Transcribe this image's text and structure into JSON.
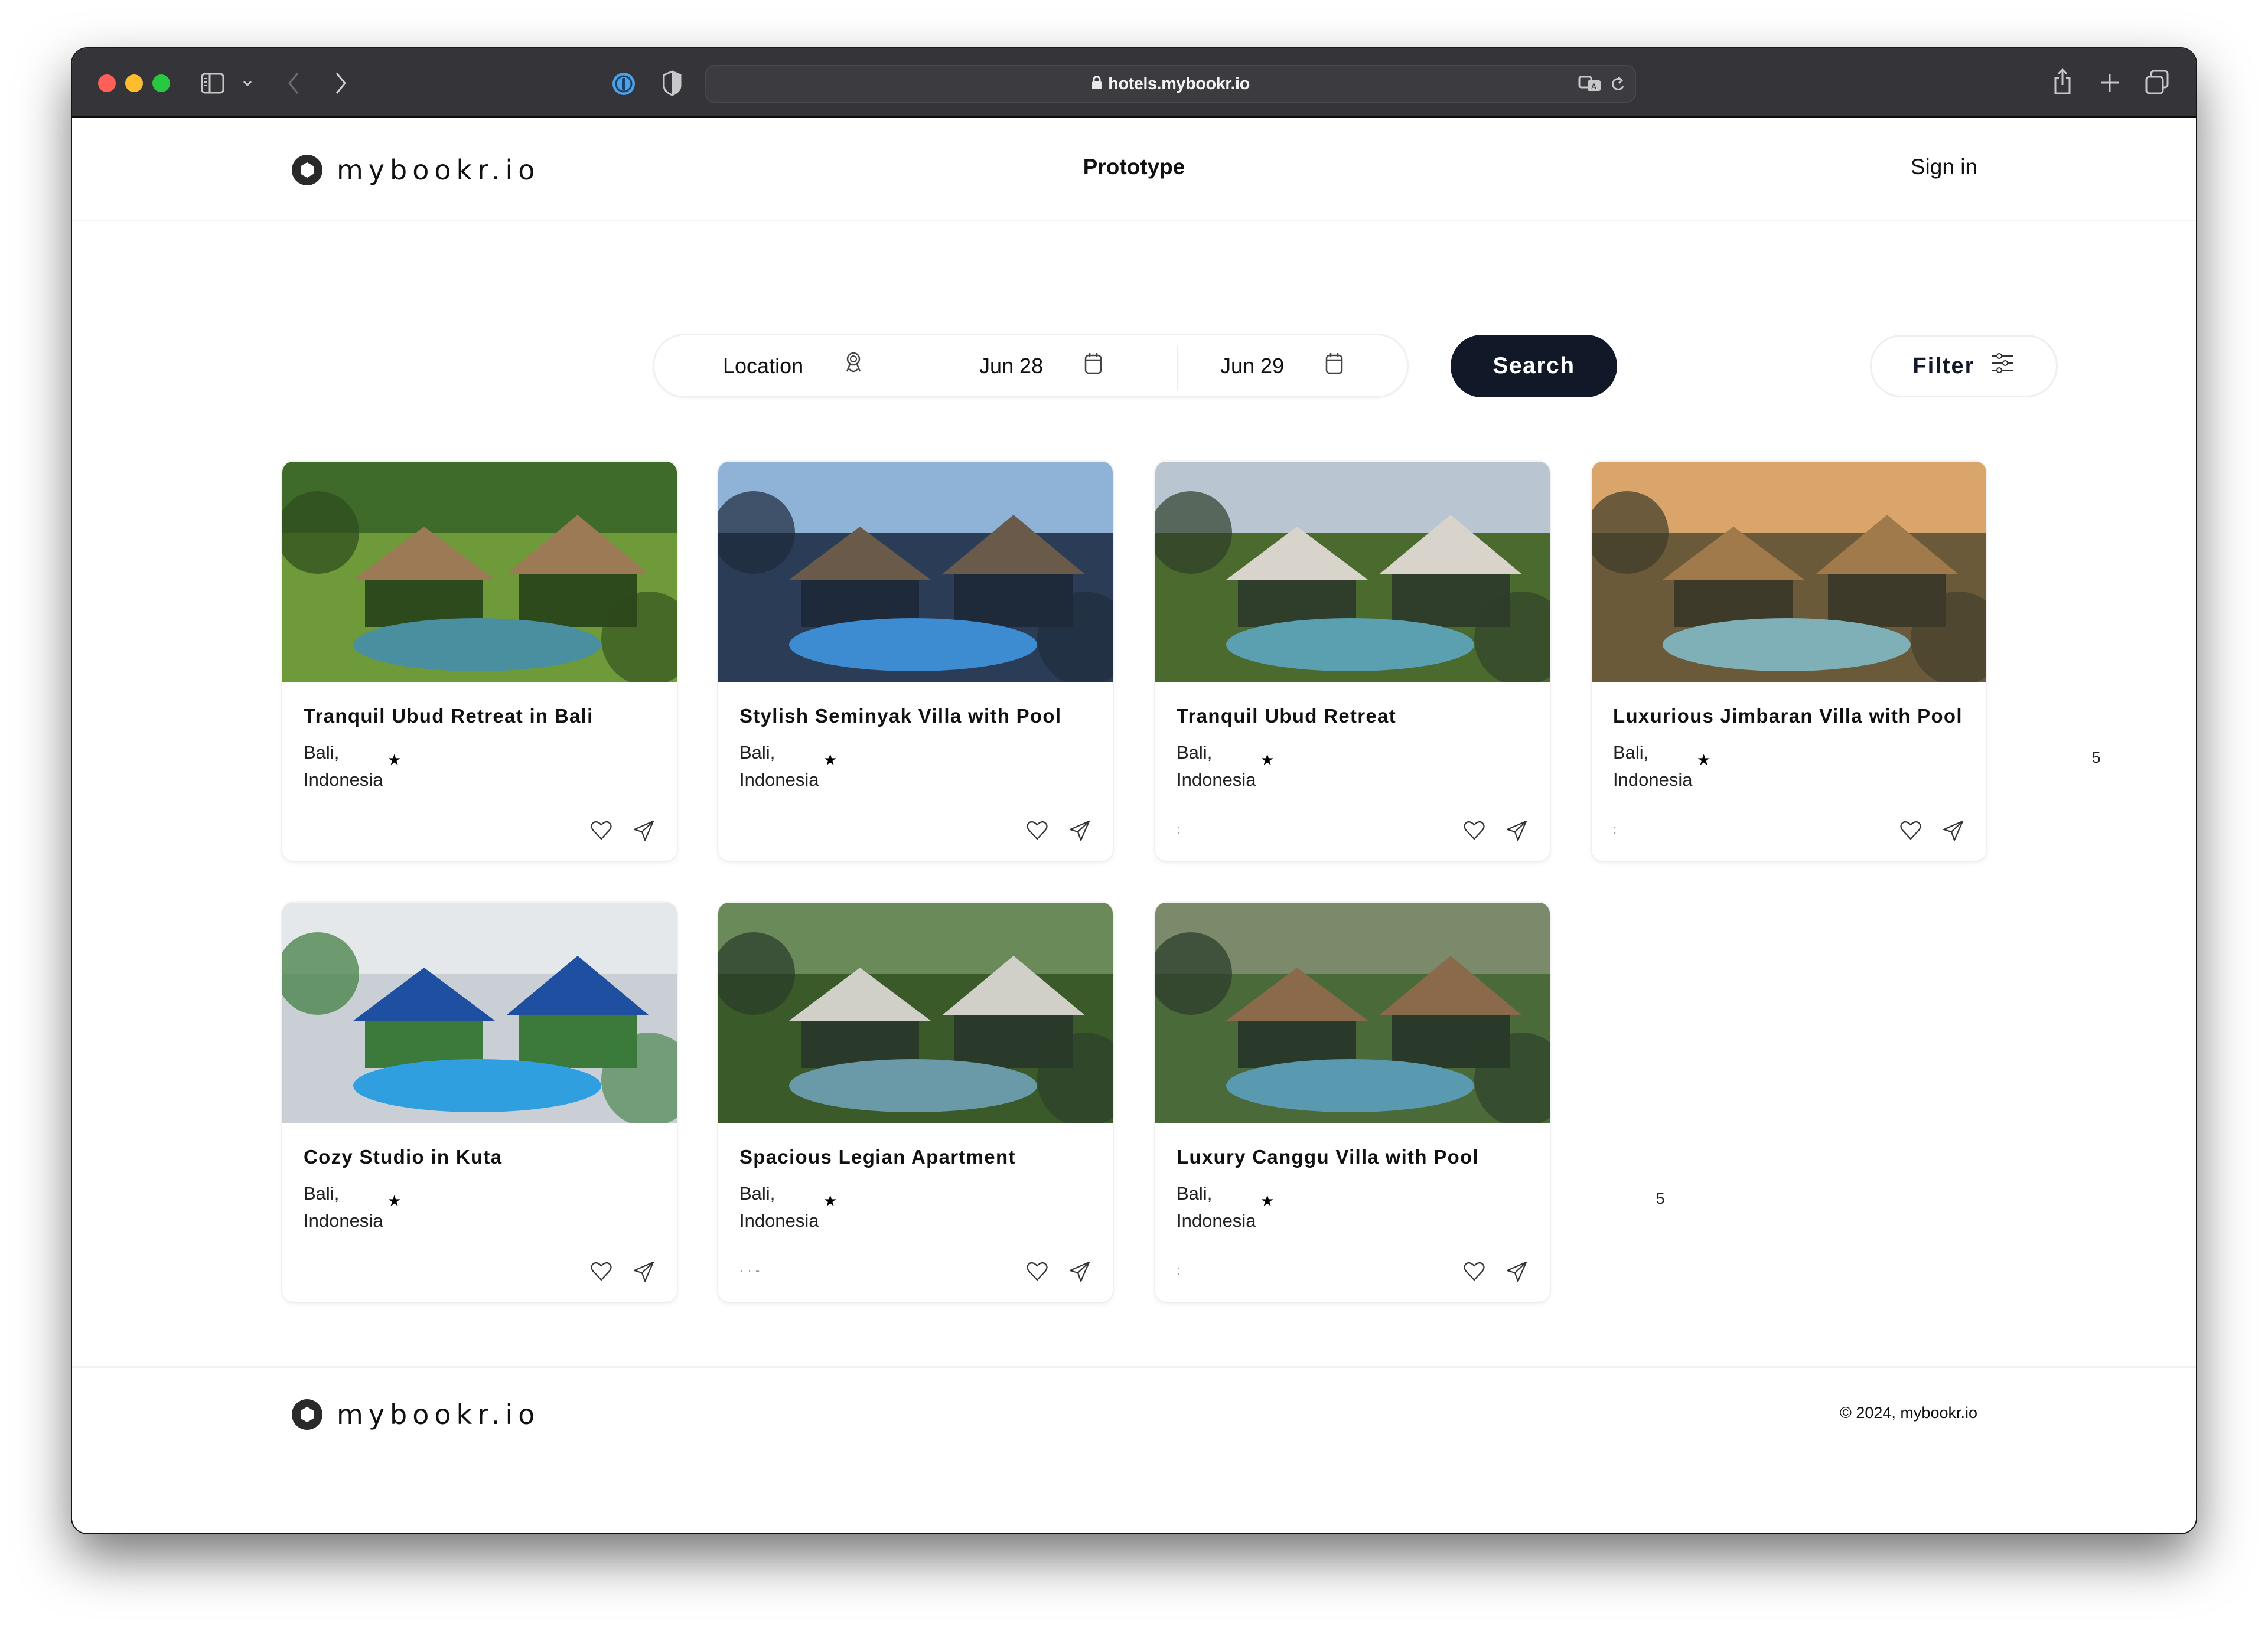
{
  "browser": {
    "url": "hotels.mybookr.io",
    "icons": [
      "close-dot",
      "minimize-dot",
      "zoom-dot",
      "sidebar-icon",
      "chevron-down-icon",
      "back-icon",
      "forward-icon",
      "password-manager-icon",
      "privacy-shield-icon",
      "lock-icon",
      "translate-icon",
      "reload-icon",
      "share-icon",
      "new-tab-icon",
      "tabs-overview-icon"
    ],
    "colors": {
      "close": "#ff5f57",
      "minimize": "#febc2e",
      "zoom": "#28c840",
      "chrome": "#353438"
    }
  },
  "header": {
    "logo_text": "mybookr.io",
    "center_label": "Prototype",
    "sign_in": "Sign in"
  },
  "search": {
    "location_placeholder": "Location",
    "check_in": "Jun 28",
    "check_out": "Jun 29",
    "search_button": "Search",
    "filter_button": "Filter",
    "accent": "#111827"
  },
  "listings": [
    {
      "title": "Tranquil Ubud Retreat in Bali",
      "city": "Bali,",
      "country": "Indonesia",
      "rating_icon": "★",
      "footer_mark": ""
    },
    {
      "title": "Stylish Seminyak Villa with Pool",
      "city": "Bali,",
      "country": "Indonesia",
      "rating_icon": "★",
      "footer_mark": ""
    },
    {
      "title": "Tranquil Ubud Retreat",
      "city": "Bali,",
      "country": "Indonesia",
      "rating_icon": "★",
      "footer_mark": ":"
    },
    {
      "title": "Luxurious Jimbaran Villa with Pool",
      "city": "Bali,",
      "country": "Indonesia",
      "rating_icon": "★",
      "footer_mark": ":"
    },
    {
      "title": "Cozy Studio in Kuta",
      "city": "Bali,",
      "country": "Indonesia",
      "rating_icon": "★",
      "footer_mark": ""
    },
    {
      "title": "Spacious Legian Apartment",
      "city": "Bali,",
      "country": "Indonesia",
      "rating_icon": "★",
      "footer_mark": "· · -"
    },
    {
      "title": "Luxury Canggu Villa with Pool",
      "city": "Bali,",
      "country": "Indonesia",
      "rating_icon": "★",
      "footer_mark": ":"
    }
  ],
  "stray_text": {
    "row1": "5",
    "row2": "5"
  },
  "footer": {
    "logo_text": "mybookr.io",
    "copyright": "© 2024, mybookr.io"
  }
}
